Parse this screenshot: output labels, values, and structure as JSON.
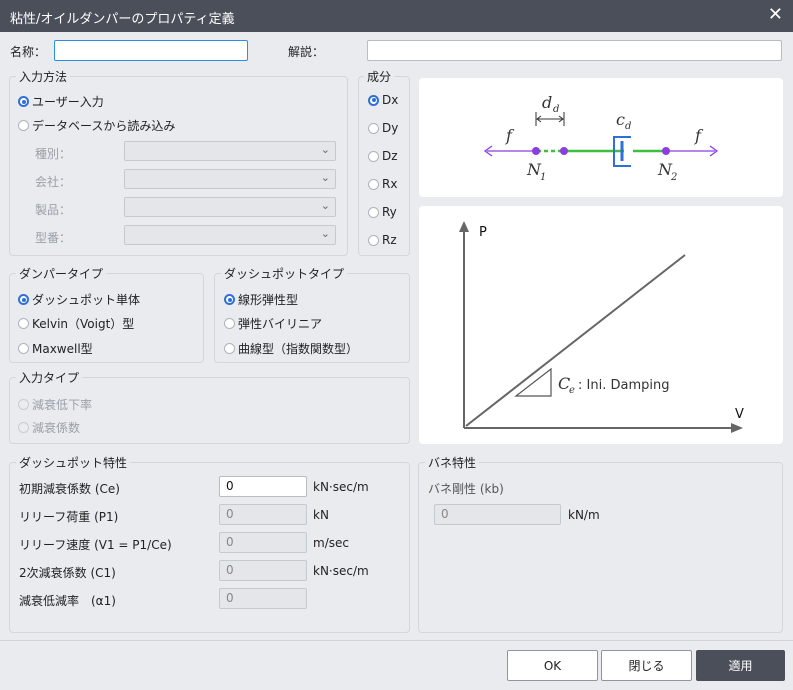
{
  "window": {
    "title": "粘性/オイルダンパーのプロパティ定義",
    "close_glyph": "✕"
  },
  "name_field": {
    "label": "名称：",
    "value": ""
  },
  "desc_field": {
    "label": "解説：",
    "value": ""
  },
  "input_method": {
    "title": "入力方法",
    "user_input": "ユーザー入力",
    "database": "データベースから読み込み",
    "type_label": "種別：",
    "company_label": "会社：",
    "product_label": "製品：",
    "model_label": "型番："
  },
  "component": {
    "title": "成分",
    "options": [
      "Dx",
      "Dy",
      "Dz",
      "Rx",
      "Ry",
      "Rz"
    ],
    "selected": "Dx"
  },
  "damper_type": {
    "title": "ダンパータイプ",
    "options": [
      "ダッシュポット単体",
      "Kelvin（Voigt）型",
      "Maxwell型"
    ]
  },
  "dashpot_type": {
    "title": "ダッシュポットタイプ",
    "options": [
      "線形弾性型",
      "弾性バイリニア",
      "曲線型（指数関数型）"
    ]
  },
  "input_type": {
    "title": "入力タイプ",
    "options": [
      "減衰低下率",
      "減衰係数"
    ]
  },
  "dashpot_props": {
    "title": "ダッシュポット特性",
    "rows": [
      {
        "label": "初期減衰係数 (Ce)",
        "value": "0",
        "unit": "kN·sec/m"
      },
      {
        "label": "リリーフ荷重 (P1)",
        "value": "0",
        "unit": "kN"
      },
      {
        "label": "リリーフ速度 (V1 = P1/Ce)",
        "value": "0",
        "unit": "m/sec"
      },
      {
        "label": "2次減衰係数 (C1)",
        "value": "0",
        "unit": "kN·sec/m"
      },
      {
        "label": "減衰低減率　(α1)",
        "value": "0",
        "unit": ""
      }
    ]
  },
  "spring_props": {
    "title": "バネ特性",
    "label": "バネ剛性 (kb)",
    "value": "0",
    "unit": "kN/m"
  },
  "diagram": {
    "f_left": "f",
    "f_right": "f",
    "dd": "d",
    "dd_sub": "d",
    "cd": "c",
    "cd_sub": "d",
    "n1": "N",
    "n1_sub": "1",
    "n2": "N",
    "n2_sub": "2"
  },
  "graph": {
    "y_label": "P",
    "x_label": "V",
    "slope_label": "C",
    "slope_sub": "e",
    "slope_text": ": Ini. Damping"
  },
  "buttons": {
    "ok": "OK",
    "close": "閉じる",
    "apply": "適用"
  },
  "colors": {
    "accent": "#2f6fd6",
    "link_green": "#3ec03e",
    "node_purple": "#8a3ee0",
    "damper_blue": "#2f6fd6"
  }
}
